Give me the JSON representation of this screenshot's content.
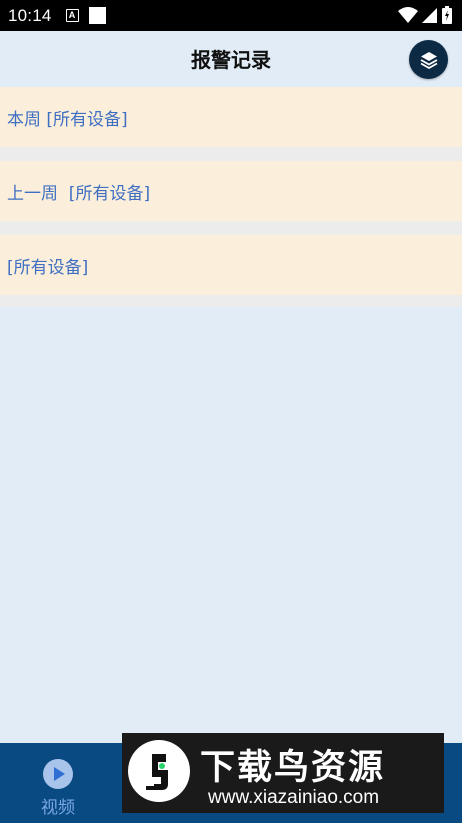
{
  "status_bar": {
    "time": "10:14",
    "notification_icon_letter": "A",
    "icons": [
      "wifi-icon",
      "signal-icon",
      "battery-icon"
    ]
  },
  "header": {
    "title": "报警记录",
    "layers_icon": "layers-icon"
  },
  "records": [
    {
      "label": "本周 [所有设备]"
    },
    {
      "label": "上一周  [所有设备]"
    },
    {
      "label": "[所有设备]"
    }
  ],
  "bottom_nav": {
    "items": [
      {
        "label": "视频",
        "icon": "video-play-icon"
      }
    ]
  },
  "watermark": {
    "title": "下载鸟资源",
    "url": "www.xiazainiao.com"
  },
  "colors": {
    "background": "#e2ecf6",
    "record_bg": "#fbeeda",
    "record_text": "#3f6fc2",
    "nav_bg": "#0a4a82",
    "layers_button": "#0d2a45"
  }
}
